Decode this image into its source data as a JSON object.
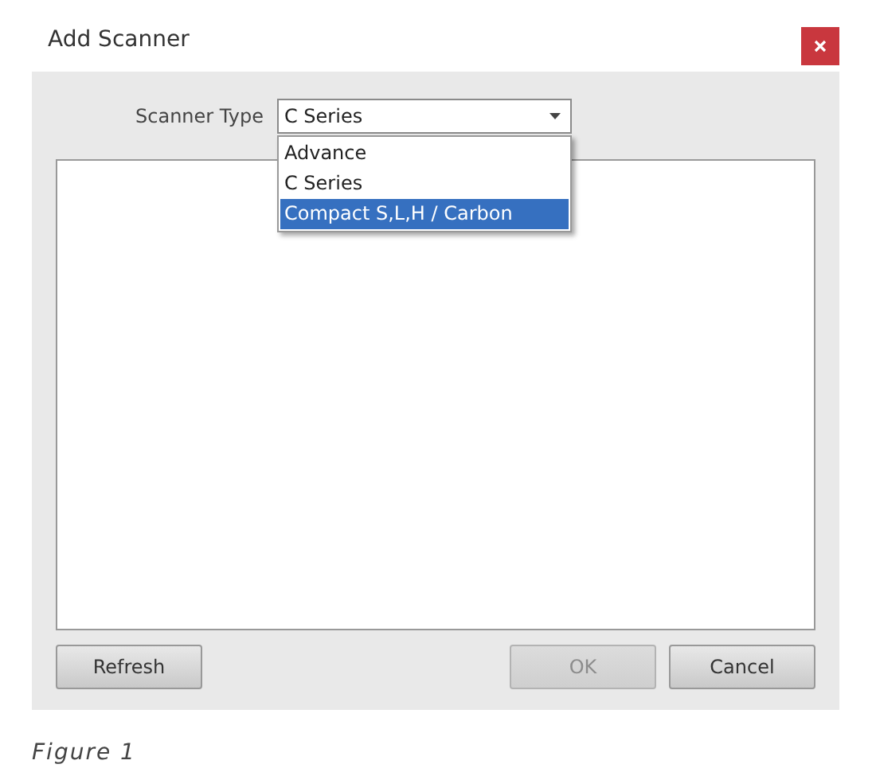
{
  "window": {
    "title": "Add Scanner"
  },
  "scanner_type": {
    "label": "Scanner Type",
    "value": "C Series",
    "expanded": true,
    "options": [
      {
        "label": "Advance",
        "highlighted": false
      },
      {
        "label": "C Series",
        "highlighted": false
      },
      {
        "label": "Compact S,L,H / Carbon",
        "highlighted": true
      }
    ]
  },
  "buttons": [
    {
      "label": "Refresh",
      "disabled": false
    },
    {
      "label": "OK",
      "disabled": true
    },
    {
      "label": "Cancel",
      "disabled": false
    }
  ],
  "caption": "Figure 1"
}
